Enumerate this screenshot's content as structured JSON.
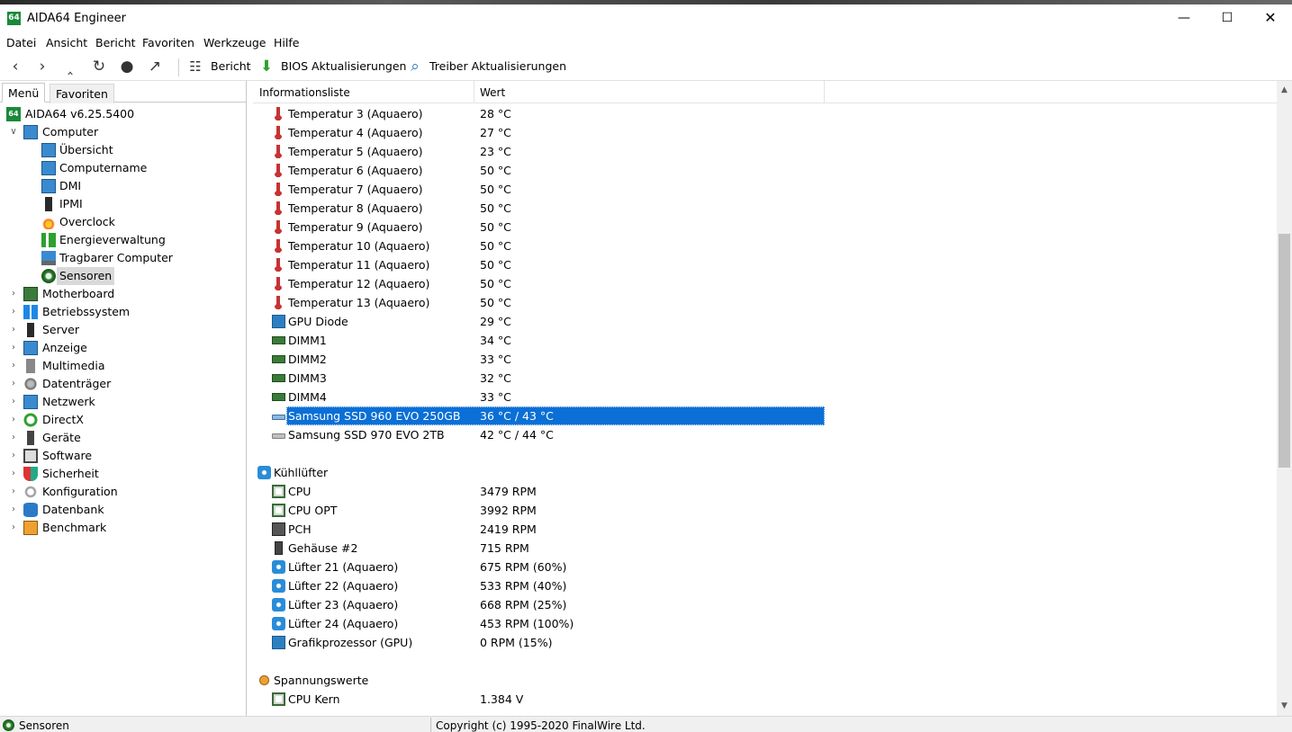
{
  "window": {
    "app_logo": "64",
    "title": "AIDA64 Engineer",
    "minimize": "—",
    "maximize": "☐",
    "close": "✕"
  },
  "menu": [
    "Datei",
    "Ansicht",
    "Bericht",
    "Favoriten",
    "Werkzeuge",
    "Hilfe"
  ],
  "toolbar": {
    "report_label": "Bericht",
    "bios_label": "BIOS Aktualisierungen",
    "driver_label": "Treiber Aktualisierungen"
  },
  "left": {
    "tabs": {
      "menu": "Menü",
      "favorites": "Favoriten"
    },
    "root": "AIDA64 v6.25.5400",
    "computer": "Computer",
    "computer_children": [
      "Übersicht",
      "Computername",
      "DMI",
      "IPMI",
      "Overclock",
      "Energieverwaltung",
      "Tragbarer Computer",
      "Sensoren"
    ],
    "groups": [
      "Motherboard",
      "Betriebssystem",
      "Server",
      "Anzeige",
      "Multimedia",
      "Datenträger",
      "Netzwerk",
      "DirectX",
      "Geräte",
      "Software",
      "Sicherheit",
      "Konfiguration",
      "Datenbank",
      "Benchmark"
    ]
  },
  "list": {
    "col_name": "Informationsliste",
    "col_value": "Wert",
    "temps": [
      {
        "name": "Temperatur 3 (Aquaero)",
        "value": "28 °C"
      },
      {
        "name": "Temperatur 4 (Aquaero)",
        "value": "27 °C"
      },
      {
        "name": "Temperatur 5 (Aquaero)",
        "value": "23 °C"
      },
      {
        "name": "Temperatur 6 (Aquaero)",
        "value": "50 °C"
      },
      {
        "name": "Temperatur 7 (Aquaero)",
        "value": "50 °C"
      },
      {
        "name": "Temperatur 8 (Aquaero)",
        "value": "50 °C"
      },
      {
        "name": "Temperatur 9 (Aquaero)",
        "value": "50 °C"
      },
      {
        "name": "Temperatur 10 (Aquaero)",
        "value": "50 °C"
      },
      {
        "name": "Temperatur 11 (Aquaero)",
        "value": "50 °C"
      },
      {
        "name": "Temperatur 12 (Aquaero)",
        "value": "50 °C"
      },
      {
        "name": "Temperatur 13 (Aquaero)",
        "value": "50 °C"
      }
    ],
    "gpu_diode": {
      "name": "GPU Diode",
      "value": "29 °C"
    },
    "dimms": [
      {
        "name": "DIMM1",
        "value": "34 °C"
      },
      {
        "name": "DIMM2",
        "value": "33 °C"
      },
      {
        "name": "DIMM3",
        "value": "32 °C"
      },
      {
        "name": "DIMM4",
        "value": "33 °C"
      }
    ],
    "ssd1": {
      "name": "Samsung SSD 960 EVO 250GB",
      "value": "36 °C / 43 °C"
    },
    "ssd2": {
      "name": "Samsung SSD 970 EVO 2TB",
      "value": "42 °C / 44 °C"
    },
    "fans_group": "Kühllüfter",
    "fans": [
      {
        "name": "CPU",
        "value": "3479 RPM"
      },
      {
        "name": "CPU OPT",
        "value": "3992 RPM"
      },
      {
        "name": "PCH",
        "value": "2419 RPM"
      },
      {
        "name": "Gehäuse #2",
        "value": "715 RPM"
      },
      {
        "name": "Lüfter 21 (Aquaero)",
        "value": "675 RPM  (60%)"
      },
      {
        "name": "Lüfter 22 (Aquaero)",
        "value": "533 RPM  (40%)"
      },
      {
        "name": "Lüfter 23 (Aquaero)",
        "value": "668 RPM  (25%)"
      },
      {
        "name": "Lüfter 24 (Aquaero)",
        "value": "453 RPM  (100%)"
      },
      {
        "name": "Grafikprozessor (GPU)",
        "value": "0 RPM  (15%)"
      }
    ],
    "volt_group": "Spannungswerte",
    "volts": [
      {
        "name": "CPU Kern",
        "value": "1.384 V"
      }
    ]
  },
  "status": {
    "left": "Sensoren",
    "right": "Copyright (c) 1995-2020 FinalWire Ltd."
  }
}
